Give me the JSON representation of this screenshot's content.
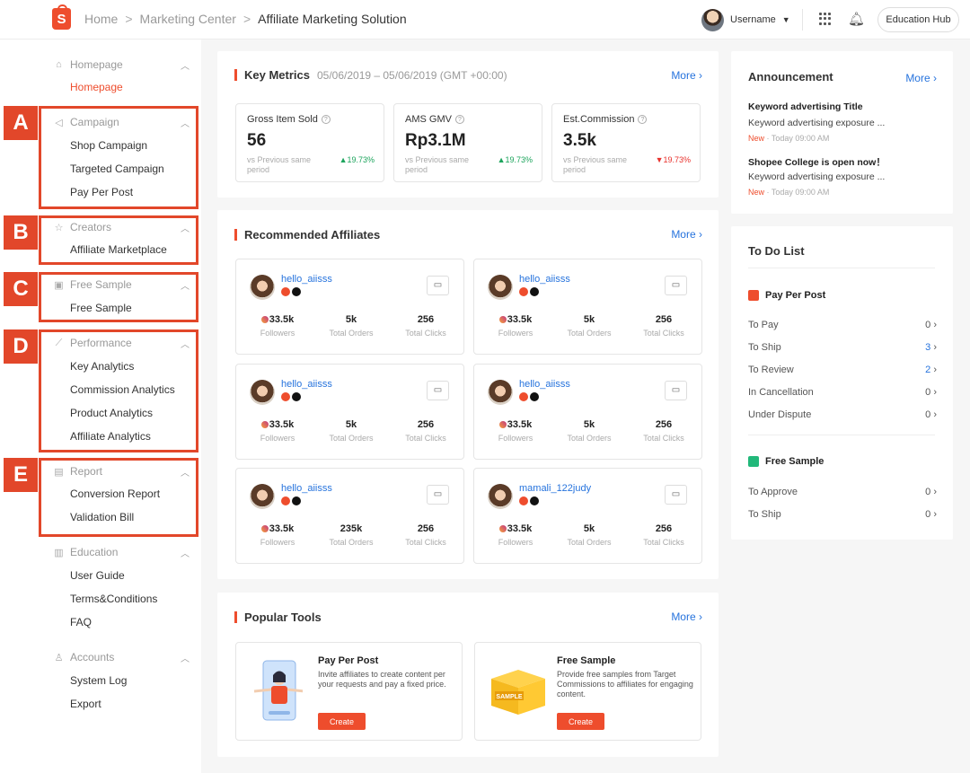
{
  "header": {
    "breadcrumbs": [
      "Home",
      "Marketing Center",
      "Affiliate Marketing Solution"
    ],
    "username": "Username",
    "education_hub": "Education Hub",
    "brand_color": "#ee4d2d"
  },
  "sidebar": {
    "sections": [
      {
        "title": "Homepage",
        "items": [
          "Homepage"
        ]
      },
      {
        "title": "Campaign",
        "items": [
          "Shop Campaign",
          "Targeted Campaign",
          "Pay Per Post"
        ]
      },
      {
        "title": "Creators",
        "items": [
          "Affiliate Marketplace"
        ]
      },
      {
        "title": "Free Sample",
        "items": [
          "Free Sample"
        ]
      },
      {
        "title": "Performance",
        "items": [
          "Key Analytics",
          "Commission Analytics",
          "Product Analytics",
          "Affiliate Analytics"
        ]
      },
      {
        "title": "Report",
        "items": [
          "Conversion Report",
          "Validation Bill"
        ]
      },
      {
        "title": "Education",
        "items": [
          "User Guide",
          "Terms&Conditions",
          "FAQ"
        ]
      },
      {
        "title": "Accounts",
        "items": [
          "System Log",
          "Export"
        ]
      }
    ],
    "highlight_labels": [
      "A",
      "B",
      "C",
      "D",
      "E"
    ],
    "highlight_color": "#e2472a"
  },
  "key_metrics": {
    "title": "Key Metrics",
    "date_range": "05/06/2019 – 05/06/2019 (GMT +00:00)",
    "more": "More",
    "metrics": [
      {
        "label": "Gross Item Sold",
        "value": "56",
        "vs": "vs Previous same period",
        "change": "▲19.73%",
        "direction": "up"
      },
      {
        "label": "AMS GMV",
        "value": "Rp3.1M",
        "vs": "vs Previous same period",
        "change": "▲19.73%",
        "direction": "up"
      },
      {
        "label": "Est.Commission",
        "value": "3.5k",
        "vs": "vs Previous same period",
        "change": "▼19.73%",
        "direction": "down"
      }
    ]
  },
  "recommended": {
    "title": "Recommended Affiliates",
    "more": "More",
    "stat_labels": [
      "Followers",
      "Total Orders",
      "Total Clicks"
    ],
    "affiliates": [
      {
        "name": "hello_aiisss",
        "followers": "33.5k",
        "orders": "5k",
        "clicks": "256"
      },
      {
        "name": "hello_aiisss",
        "followers": "33.5k",
        "orders": "5k",
        "clicks": "256"
      },
      {
        "name": "hello_aiisss",
        "followers": "33.5k",
        "orders": "5k",
        "clicks": "256"
      },
      {
        "name": "hello_aiisss",
        "followers": "33.5k",
        "orders": "5k",
        "clicks": "256"
      },
      {
        "name": "hello_aiisss",
        "followers": "33.5k",
        "orders": "235k",
        "clicks": "256"
      },
      {
        "name": "mamali_122judy",
        "followers": "33.5k",
        "orders": "5k",
        "clicks": "256"
      }
    ]
  },
  "popular_tools": {
    "title": "Popular Tools",
    "more": "More",
    "tools": [
      {
        "name": "Pay Per Post",
        "desc": "Invite affiliates to create content per your requests and pay a fixed price.",
        "button": "Create"
      },
      {
        "name": "Free Sample",
        "desc": "Provide free samples from Target Commissions to affiliates for engaging content.",
        "button": "Create",
        "image_text": "SAMPLE"
      }
    ]
  },
  "announcement": {
    "title": "Announcement",
    "more": "More",
    "items": [
      {
        "title": "Keyword advertising Title",
        "desc": "Keyword advertising exposure ...",
        "tag": "New",
        "time": "· Today 09:00 AM"
      },
      {
        "title": "Shopee College is open now！",
        "desc": "Keyword advertising exposure ...",
        "tag": "New",
        "time": "· Today 09:00 AM"
      }
    ]
  },
  "todo": {
    "title": "To Do List",
    "sections": [
      {
        "title": "Pay Per Post",
        "rows": [
          {
            "label": "To Pay",
            "count": "0"
          },
          {
            "label": "To Ship",
            "count": "3"
          },
          {
            "label": "To Review",
            "count": "2"
          },
          {
            "label": "In Cancellation",
            "count": "0"
          },
          {
            "label": "Under Dispute",
            "count": "0"
          }
        ]
      },
      {
        "title": "Free Sample",
        "rows": [
          {
            "label": "To Approve",
            "count": "0"
          },
          {
            "label": "To Ship",
            "count": "0"
          }
        ]
      }
    ]
  }
}
